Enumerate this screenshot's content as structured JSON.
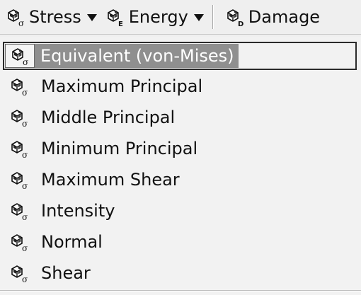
{
  "toolbar": {
    "buttons": [
      {
        "label": "Stress",
        "icon": "stress-sigma-icon",
        "has_dropdown": true
      },
      {
        "label": "Energy",
        "icon": "energy-e-icon",
        "has_dropdown": true
      },
      {
        "label": "Damage",
        "icon": "damage-d-icon",
        "has_dropdown": false
      }
    ]
  },
  "menu": {
    "items": [
      {
        "label": "Equivalent (von-Mises)",
        "icon": "stress-sigma-icon",
        "selected": true
      },
      {
        "label": "Maximum Principal",
        "icon": "stress-sigma-icon",
        "selected": false
      },
      {
        "label": "Middle Principal",
        "icon": "stress-sigma-icon",
        "selected": false
      },
      {
        "label": "Minimum Principal",
        "icon": "stress-sigma-icon",
        "selected": false
      },
      {
        "label": "Maximum Shear",
        "icon": "stress-sigma-icon",
        "selected": false
      },
      {
        "label": "Intensity",
        "icon": "stress-sigma-icon",
        "selected": false
      },
      {
        "label": "Normal",
        "icon": "stress-sigma-icon",
        "selected": false
      },
      {
        "label": "Shear",
        "icon": "stress-sigma-icon",
        "selected": false
      }
    ]
  },
  "colors": {
    "selection_bg": "#8f8f8f",
    "menu_bg": "#f2f2f2",
    "toolbar_bg": "#efefef"
  }
}
